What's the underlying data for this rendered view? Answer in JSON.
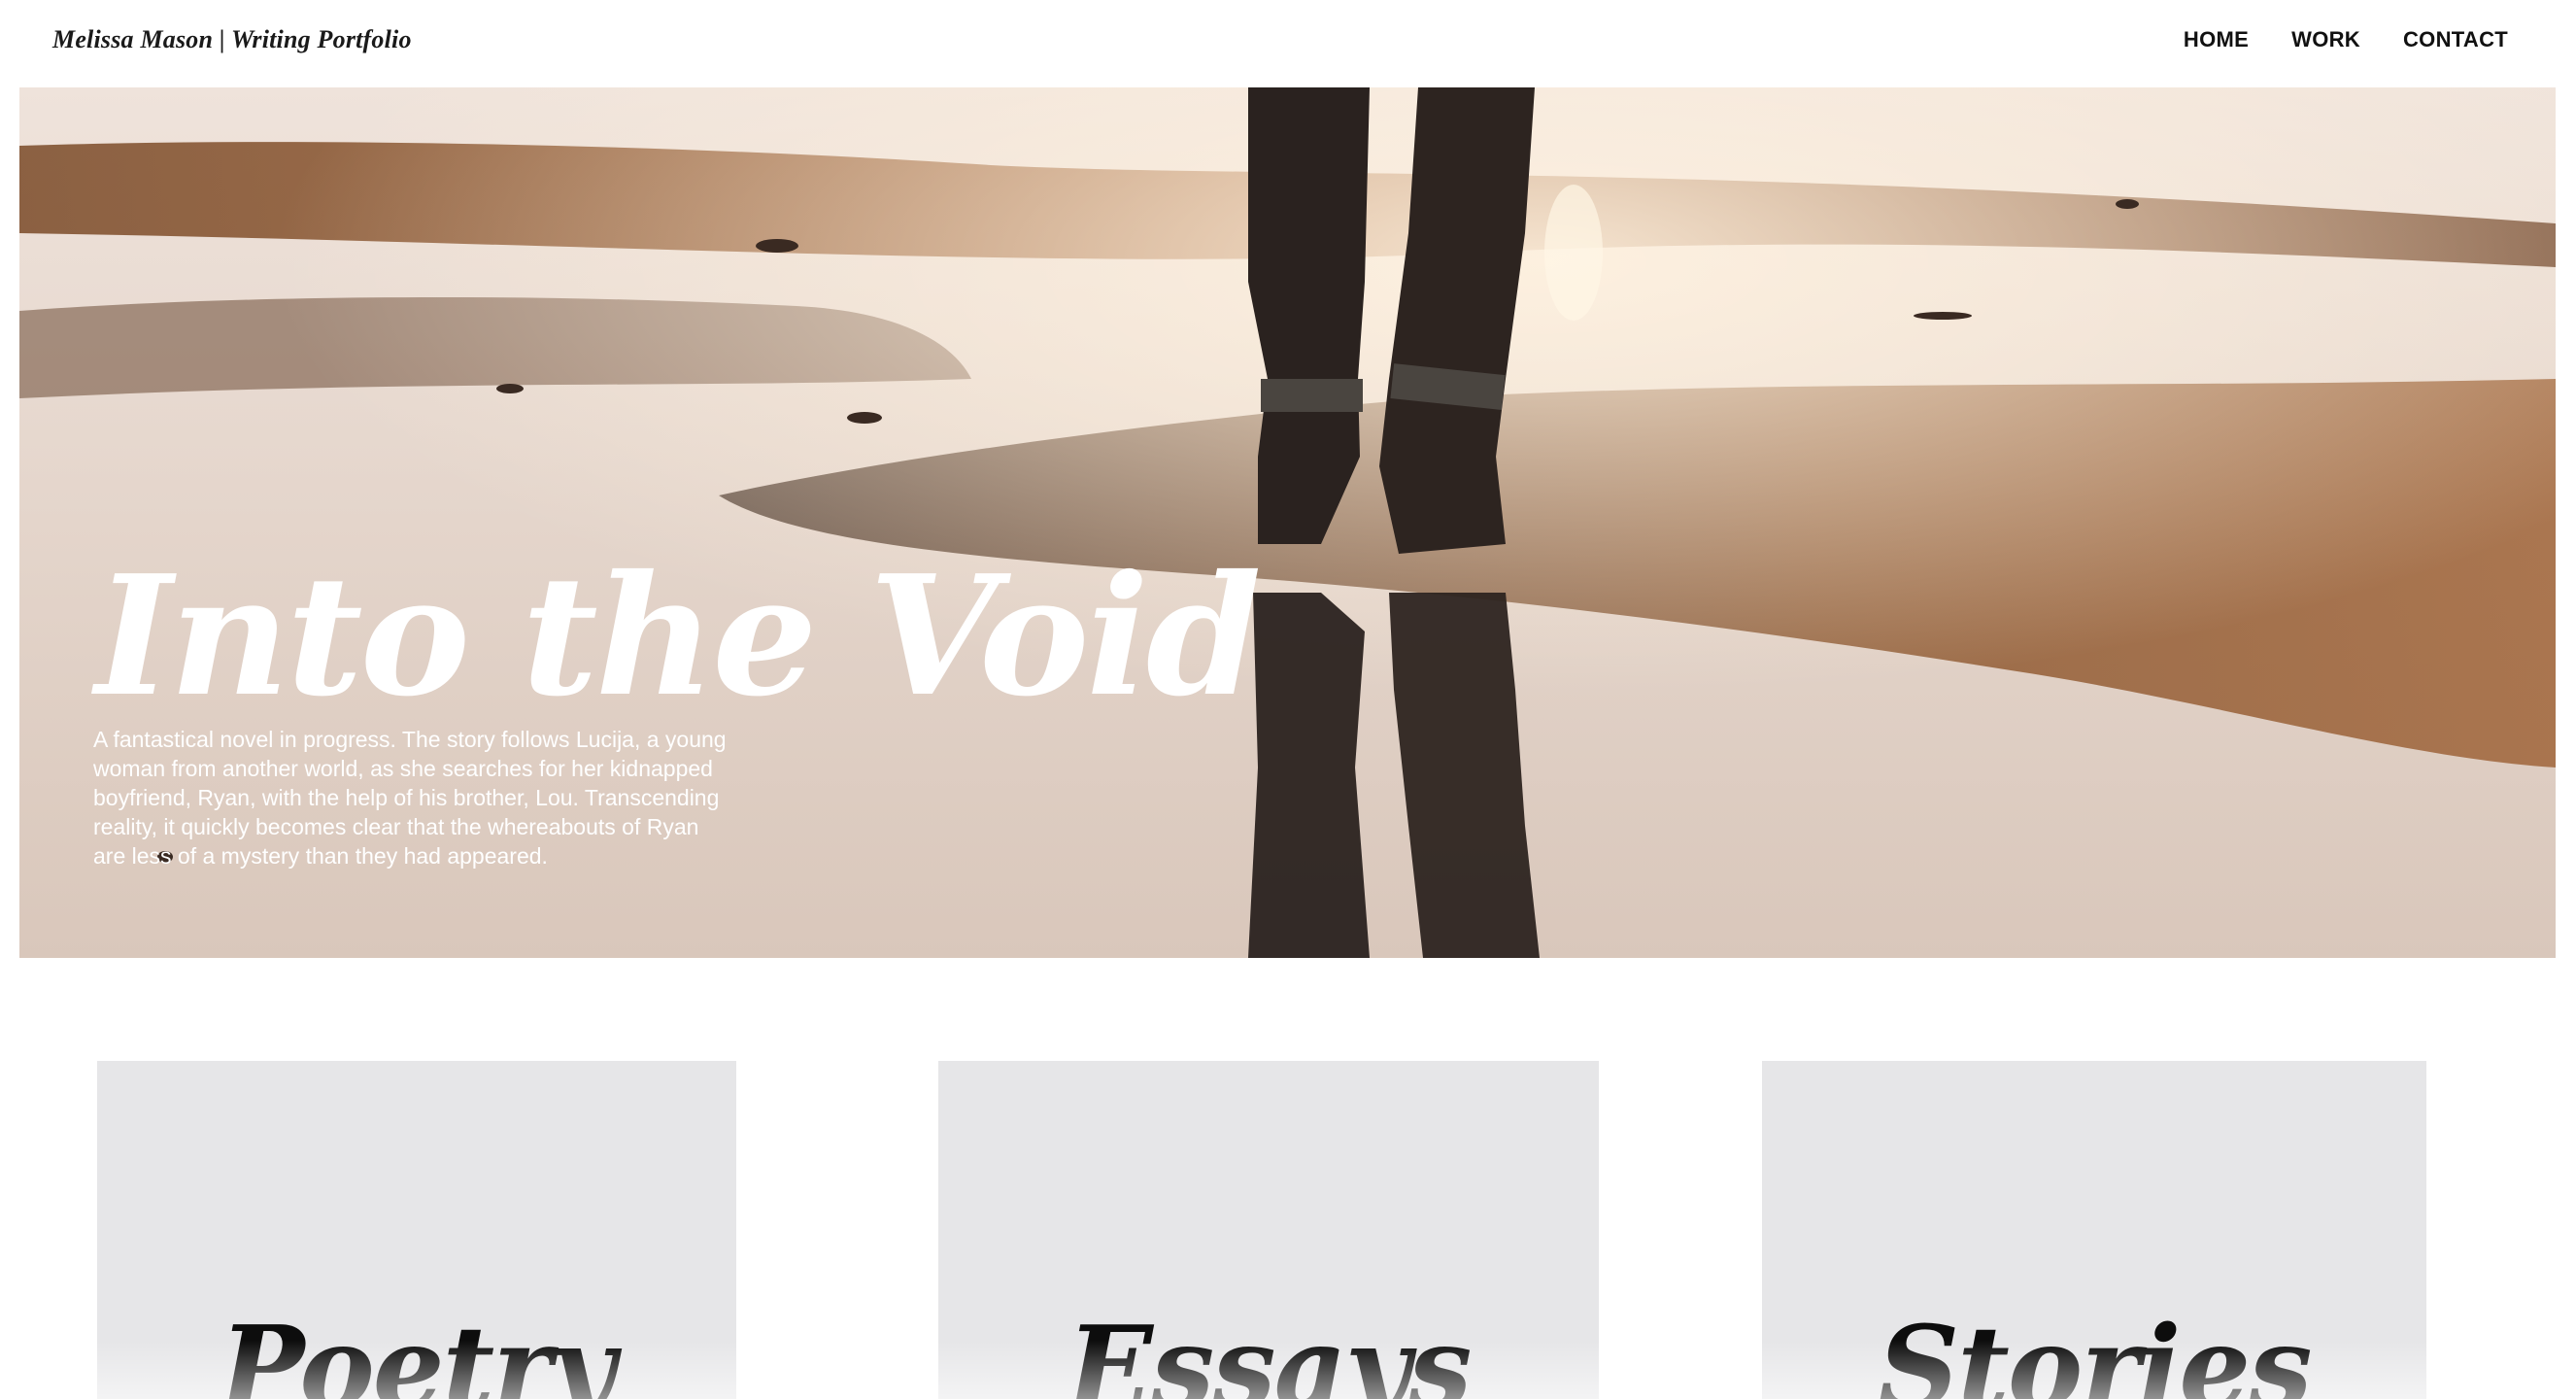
{
  "header": {
    "brand": "Melissa Mason | Writing Portfolio",
    "nav": [
      {
        "label": "HOME"
      },
      {
        "label": "WORK"
      },
      {
        "label": "CONTACT"
      }
    ]
  },
  "hero": {
    "title": "Into the Void",
    "description": "A fantastical novel in progress. The story follows Lucija, a young woman from another world, as she searches for her kidnapped boyfriend, Ryan, with the help of his brother, Lou. Transcending reality, it quickly becomes clear that the whereabouts of Ryan are less of a mystery than they had appeared."
  },
  "cards": [
    {
      "title": "Poetry"
    },
    {
      "title": "Essays"
    },
    {
      "title": "Stories"
    }
  ],
  "colors": {
    "card_bg": "#e6e6e8",
    "sand_dark": "#8a5a35",
    "sand_light": "#e6d6cc",
    "text_light": "#ffffff"
  }
}
